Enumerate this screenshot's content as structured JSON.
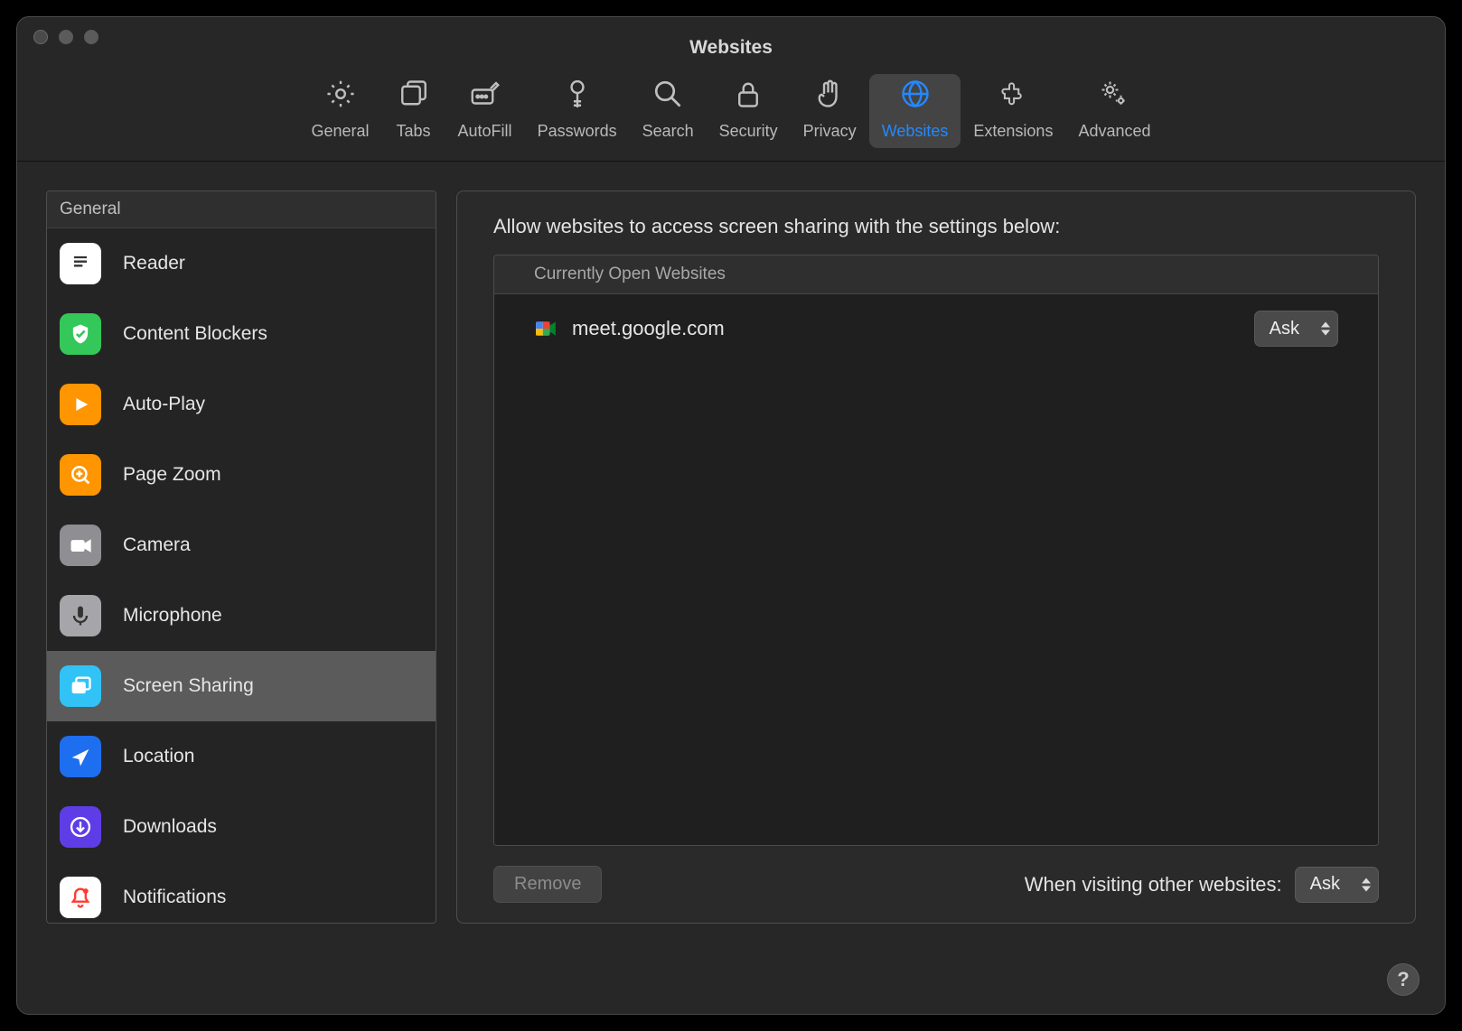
{
  "window": {
    "title": "Websites"
  },
  "toolbar": {
    "items": [
      {
        "label": "General"
      },
      {
        "label": "Tabs"
      },
      {
        "label": "AutoFill"
      },
      {
        "label": "Passwords"
      },
      {
        "label": "Search"
      },
      {
        "label": "Security"
      },
      {
        "label": "Privacy"
      },
      {
        "label": "Websites"
      },
      {
        "label": "Extensions"
      },
      {
        "label": "Advanced"
      }
    ]
  },
  "sidebar": {
    "section_title": "General",
    "items": [
      {
        "label": "Reader"
      },
      {
        "label": "Content Blockers"
      },
      {
        "label": "Auto-Play"
      },
      {
        "label": "Page Zoom"
      },
      {
        "label": "Camera"
      },
      {
        "label": "Microphone"
      },
      {
        "label": "Screen Sharing"
      },
      {
        "label": "Location"
      },
      {
        "label": "Downloads"
      },
      {
        "label": "Notifications"
      }
    ]
  },
  "panel": {
    "heading": "Allow websites to access screen sharing with the settings below:",
    "table_header": "Currently Open Websites",
    "rows": [
      {
        "domain": "meet.google.com",
        "setting": "Ask"
      }
    ],
    "remove_label": "Remove",
    "other_label": "When visiting other websites:",
    "other_value": "Ask"
  },
  "help_label": "?"
}
